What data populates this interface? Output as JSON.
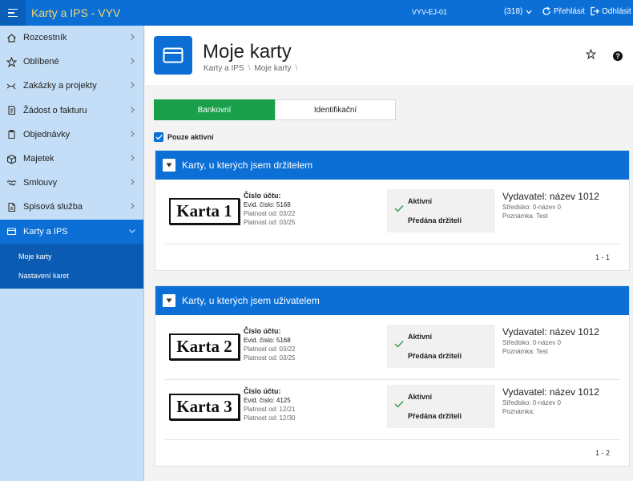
{
  "topbar": {
    "app_title": "Karty a IPS - VYV",
    "environment": "VYV-EJ-01",
    "notification_count": "(318)",
    "relogin_label": "Přehlásit",
    "logout_label": "Odhlásit"
  },
  "sidebar": {
    "items": [
      {
        "label": "Rozcestník",
        "icon": "home-icon"
      },
      {
        "label": "Oblíbené",
        "icon": "star-icon"
      },
      {
        "label": "Zakázky a projekty",
        "icon": "workflow-icon"
      },
      {
        "label": "Žádost o fakturu",
        "icon": "invoice-icon"
      },
      {
        "label": "Objednávky",
        "icon": "clipboard-icon"
      },
      {
        "label": "Majetek",
        "icon": "box-icon"
      },
      {
        "label": "Smlouvy",
        "icon": "handshake-icon"
      },
      {
        "label": "Spisová služba",
        "icon": "document-icon"
      },
      {
        "label": "Karty a IPS",
        "icon": "card-icon"
      }
    ],
    "sub_items": [
      {
        "label": "Moje karty"
      },
      {
        "label": "Nastavení karet"
      }
    ]
  },
  "header": {
    "title": "Moje karty",
    "breadcrumb": [
      "Karty a IPS",
      "Moje karty"
    ],
    "help_label": "?"
  },
  "tabs": [
    {
      "label": "Bankovní",
      "active": true
    },
    {
      "label": "Identifikační",
      "active": false
    }
  ],
  "filter": {
    "active_only_label": "Pouze aktivní",
    "checked": true
  },
  "sections": [
    {
      "title": "Karty, u kterých jsem držitelem",
      "cards": [
        {
          "card_label": "Karta 1",
          "account_label": "Číslo účtu:",
          "evid": "Evid. číslo: 5168",
          "valid_from": "Platnost od: 03/22",
          "valid_to": "Platnost od: 03/25",
          "status": "Aktivní",
          "handover": "Předána držiteli",
          "issuer": "Vydavatel: název 1012",
          "center": "Středisko: 0-název 0",
          "note": "Poznámka: Test"
        }
      ],
      "pager": "1 - 1"
    },
    {
      "title": "Karty, u kterých jsem uživatelem",
      "cards": [
        {
          "card_label": "Karta 2",
          "account_label": "Číslo účtu:",
          "evid": "Evid. číslo: 5168",
          "valid_from": "Platnost od: 03/22",
          "valid_to": "Platnost od: 03/25",
          "status": "Aktivní",
          "handover": "Předána držiteli",
          "issuer": "Vydavatel: název 1012",
          "center": "Středisko: 0-název 0",
          "note": "Poznámka: Test"
        },
        {
          "card_label": "Karta 3",
          "account_label": "Číslo účtu:",
          "evid": "Evid. číslo: 4125",
          "valid_from": "Platnost od: 12/21",
          "valid_to": "Platnost od: 12/30",
          "status": "Aktivní",
          "handover": "Předána držiteli",
          "issuer": "Vydavatel: název 1012",
          "center": "Středisko: 0-název 0",
          "note": "Poznámka:"
        }
      ],
      "pager": "1 - 2"
    }
  ],
  "colors": {
    "primary": "#0b6fd6",
    "sidebar_bg": "#c3def6",
    "active_tab": "#1aa04a",
    "title_accent": "#f5d66b",
    "status_check": "#2e9d4f"
  }
}
